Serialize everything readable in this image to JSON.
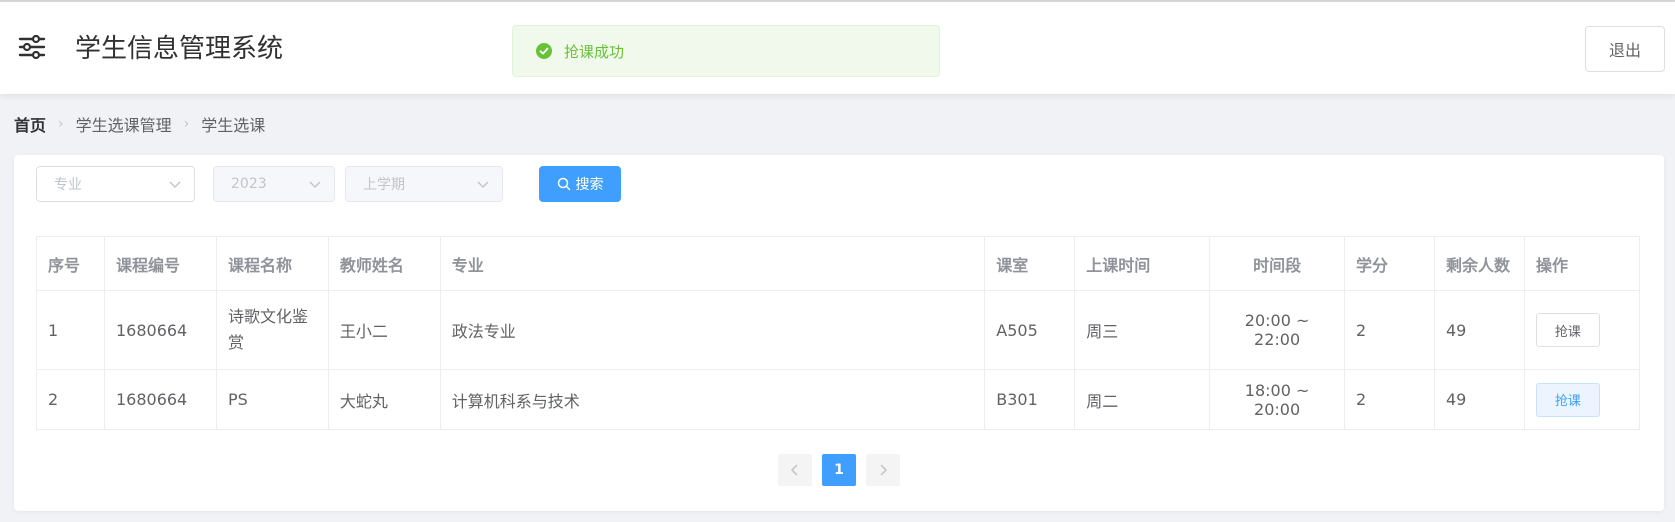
{
  "app": {
    "title": "学生信息管理系统",
    "logout_label": "退出"
  },
  "toast": {
    "message": "抢课成功",
    "color": "#67c23a"
  },
  "breadcrumb": [
    "首页",
    "学生选课管理",
    "学生选课"
  ],
  "filters": {
    "major_placeholder": "专业",
    "year_value": "2023",
    "term_value": "上学期",
    "search_label": "搜索"
  },
  "table": {
    "headers": [
      "序号",
      "课程编号",
      "课程名称",
      "教师姓名",
      "专业",
      "课室",
      "上课时间",
      "时间段",
      "学分",
      "剩余人数",
      "操作"
    ],
    "rows": [
      {
        "index": "1",
        "code": "1680664",
        "name": "诗歌文化鉴赏",
        "teacher": "王小二",
        "major": "政法专业",
        "room": "A505",
        "day": "周三",
        "time": "20:00 ~ 22:00",
        "credit": "2",
        "remaining": "49",
        "action": "抢课"
      },
      {
        "index": "2",
        "code": "1680664",
        "name": "PS",
        "teacher": "大蛇丸",
        "major": "计算机科系与技术",
        "room": "B301",
        "day": "周二",
        "time": "18:00 ~ 20:00",
        "credit": "2",
        "remaining": "49",
        "action": "抢课"
      }
    ]
  },
  "pagination": {
    "current_page": "1"
  },
  "colors": {
    "primary": "#409eff",
    "success": "#67c23a"
  }
}
